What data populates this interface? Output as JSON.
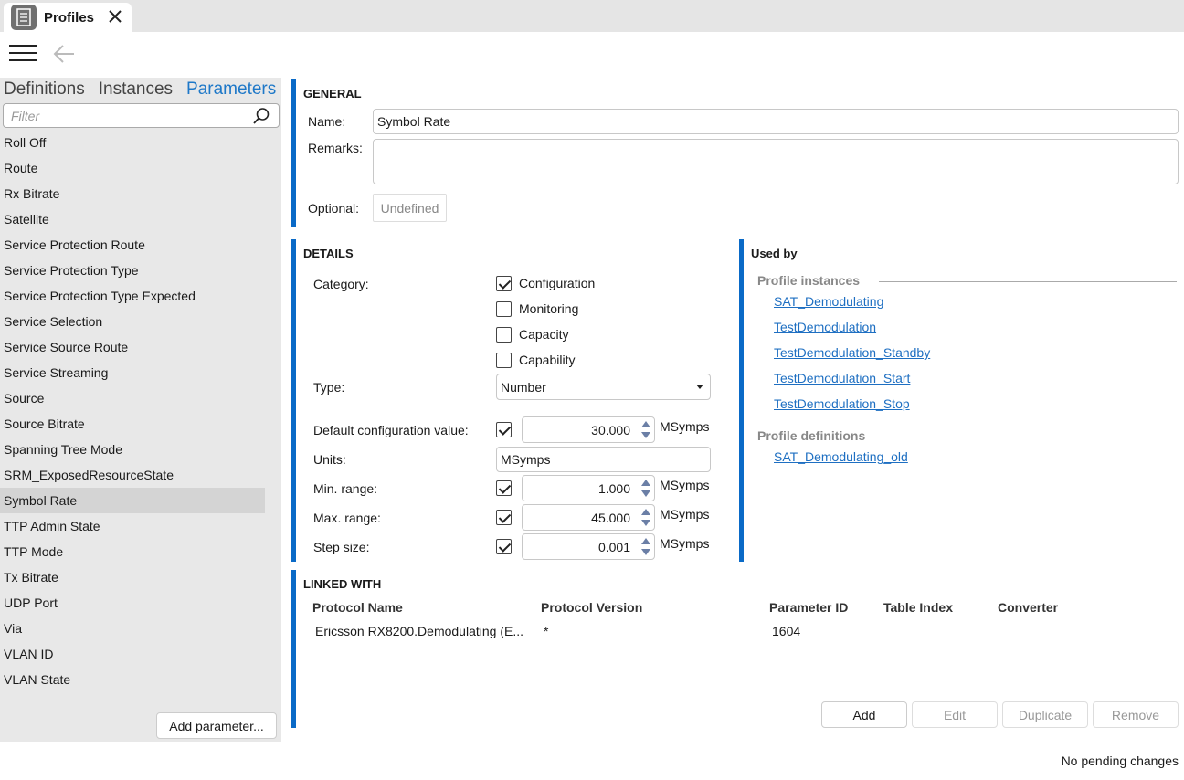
{
  "tab": {
    "title": "Profiles"
  },
  "nav": {
    "tabs": [
      "Definitions",
      "Instances",
      "Parameters"
    ],
    "active_tab": "Parameters",
    "filter_placeholder": "Filter"
  },
  "parameters": [
    "Roll Off",
    "Route",
    "Rx Bitrate",
    "Satellite",
    "Service Protection Route",
    "Service Protection Type",
    "Service Protection Type Expected",
    "Service Selection",
    "Service Source Route",
    "Service Streaming",
    "Source",
    "Source Bitrate",
    "Spanning Tree Mode",
    "SRM_ExposedResourceState",
    "Symbol Rate",
    "TTP Admin State",
    "TTP Mode",
    "Tx Bitrate",
    "UDP Port",
    "Via",
    "VLAN ID",
    "VLAN State"
  ],
  "selected_parameter": "Symbol Rate",
  "add_parameter_label": "Add parameter...",
  "general": {
    "title": "GENERAL",
    "name_label": "Name:",
    "name_value": "Symbol Rate",
    "remarks_label": "Remarks:",
    "remarks_value": "",
    "optional_label": "Optional:",
    "optional_value": "Undefined"
  },
  "details": {
    "title": "DETAILS",
    "category_label": "Category:",
    "categories": [
      {
        "label": "Configuration",
        "checked": true
      },
      {
        "label": "Monitoring",
        "checked": false
      },
      {
        "label": "Capacity",
        "checked": false
      },
      {
        "label": "Capability",
        "checked": false
      }
    ],
    "type_label": "Type:",
    "type_value": "Number",
    "default_label": "Default configuration value:",
    "default_value": "30.000",
    "default_unit": "MSymps",
    "units_label": "Units:",
    "units_value": "MSymps",
    "min_label": "Min. range:",
    "min_value": "1.000",
    "min_unit": "MSymps",
    "max_label": "Max. range:",
    "max_value": "45.000",
    "max_unit": "MSymps",
    "step_label": "Step size:",
    "step_value": "0.001",
    "step_unit": "MSymps"
  },
  "used_by": {
    "title": "Used by",
    "instances_title": "Profile instances",
    "instances": [
      "SAT_Demodulating",
      "TestDemodulation",
      "TestDemodulation_Standby",
      "TestDemodulation_Start",
      "TestDemodulation_Stop"
    ],
    "definitions_title": "Profile definitions",
    "definitions": [
      "SAT_Demodulating_old"
    ]
  },
  "linked": {
    "title": "LINKED WITH",
    "columns": [
      "Protocol Name",
      "Protocol Version",
      "Parameter ID",
      "Table Index",
      "Converter"
    ],
    "rows": [
      [
        "Ericsson RX8200.Demodulating (E...",
        "*",
        "1604",
        "",
        ""
      ]
    ],
    "buttons": {
      "add": "Add",
      "edit": "Edit",
      "duplicate": "Duplicate",
      "remove": "Remove"
    }
  },
  "status": "No pending changes",
  "colors": {
    "accent": "#0a6ac7",
    "link": "#1e6fc2",
    "active_tab": "#1e78c8"
  }
}
